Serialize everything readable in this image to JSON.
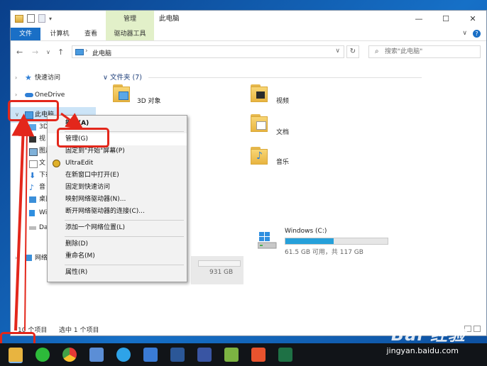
{
  "titlebar": {
    "context_tab_group": "管理",
    "window_title": "此电脑",
    "minimize_glyph": "—",
    "maximize_glyph": "☐",
    "close_glyph": "✕"
  },
  "ribbon": {
    "tabs": [
      "文件",
      "计算机",
      "查看",
      "驱动器工具"
    ],
    "expand_glyph": "∨"
  },
  "address": {
    "back_glyph": "←",
    "forward_glyph": "→",
    "recent_glyph": "∨",
    "up_glyph": "↑",
    "path": "此电脑",
    "refresh_glyph": "↻",
    "search_placeholder": "搜索\"此电脑\""
  },
  "nav_pane": {
    "items": [
      {
        "label": "快速访问",
        "icon": "star-icon"
      },
      {
        "label": "OneDrive",
        "icon": "cloud-icon"
      },
      {
        "label": "此电脑",
        "icon": "pc-icon",
        "selected": true
      },
      {
        "label": "3D",
        "icon": "3d-objects-icon"
      },
      {
        "label": "视",
        "icon": "video-icon"
      },
      {
        "label": "图片",
        "icon": "pictures-icon"
      },
      {
        "label": "文",
        "icon": "documents-icon"
      },
      {
        "label": "下载",
        "icon": "downloads-icon"
      },
      {
        "label": "音",
        "icon": "music-icon"
      },
      {
        "label": "桌面",
        "icon": "desktop-icon"
      },
      {
        "label": "Wi",
        "icon": "windows-drive-icon"
      },
      {
        "label": "Da",
        "icon": "data-drive-icon"
      },
      {
        "label": "网络",
        "icon": "network-icon"
      }
    ]
  },
  "main": {
    "group_title": "文件夹 (7)",
    "folders": [
      {
        "label": "3D 对象",
        "icon": "3d-objects-folder-icon"
      },
      {
        "label": "视频",
        "icon": "videos-folder-icon"
      },
      {
        "label": "文档",
        "icon": "documents-folder-icon"
      },
      {
        "label": "音乐",
        "icon": "music-folder-icon"
      }
    ],
    "drive": {
      "name": "Windows (C:)",
      "free_text": "61.5 GB 可用，共 117 GB",
      "used_fraction": 0.47
    },
    "hidden_drive_text": "931 GB"
  },
  "status": {
    "item_count": "10 个项目",
    "selected_count": "选中 1 个项目"
  },
  "context_menu": {
    "items": [
      {
        "label": "折叠(A)",
        "bold": true
      },
      {
        "label": "管理(G)",
        "highlighted": true
      },
      {
        "label": "固定到\"开始\"屏幕(P)"
      },
      {
        "label": "UltraEdit",
        "icon": "ultraedit-icon"
      },
      {
        "label": "在新窗口中打开(E)"
      },
      {
        "label": "固定到快速访问"
      },
      {
        "label": "映射网络驱动器(N)..."
      },
      {
        "label": "断开网络驱动器的连接(C)..."
      },
      {
        "label": "添加一个网络位置(L)"
      },
      {
        "label": "删除(D)"
      },
      {
        "label": "重命名(M)"
      },
      {
        "label": "属性(R)"
      }
    ]
  },
  "taskbar": {
    "apps": [
      "file-explorer",
      "wechat",
      "chrome",
      "remote-desktop",
      "360-browser",
      "notes",
      "word",
      "visio",
      "photos",
      "xmind",
      "excel"
    ]
  },
  "watermark": {
    "logo": "Bai 经验",
    "url": "jingyan.baidu.com"
  },
  "colors": {
    "accent": "#1a6fc6",
    "annotation_red": "#e3271b",
    "selection": "#cce4f7",
    "drive_bar": "#26a0da",
    "context_tab": "#e2f0c9"
  }
}
